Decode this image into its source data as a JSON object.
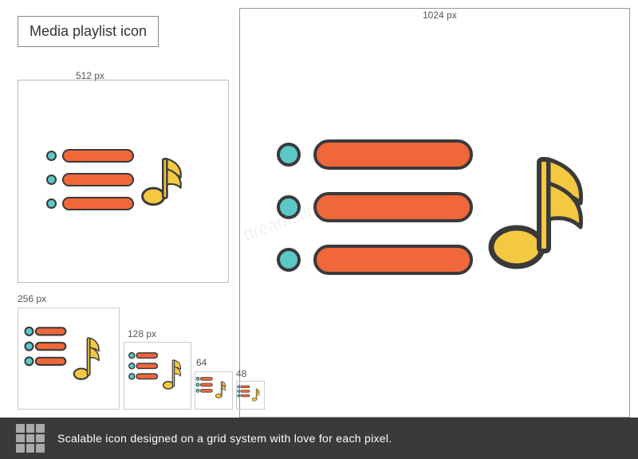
{
  "title": "Media playlist icon",
  "dimensions": {
    "outer": "1024 px",
    "preview_512": "512 px",
    "preview_256": "256 px",
    "preview_128": "128 px",
    "preview_64": "64",
    "preview_48": "48"
  },
  "bottom_bar": {
    "text": "Scalable icon designed on a grid system with love for each pixel.",
    "grid_icon": "grid-icon"
  },
  "colors": {
    "dot": "#5cc8c8",
    "bar": "#f0673a",
    "note": "#f5c842",
    "outline": "#3a3a3a",
    "background": "#ffffff"
  },
  "watermark": "dreamstime"
}
